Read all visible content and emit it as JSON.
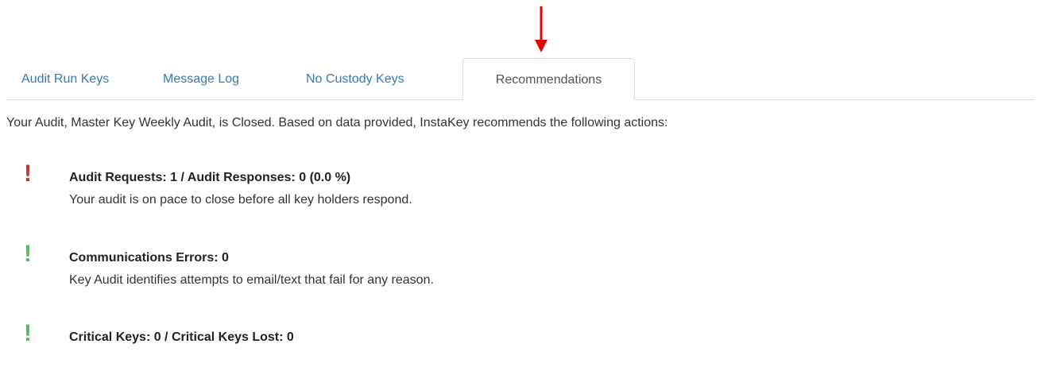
{
  "tabs": [
    {
      "label": "Audit Run Keys",
      "active": false
    },
    {
      "label": "Message Log",
      "active": false
    },
    {
      "label": "No Custody Keys",
      "active": false
    },
    {
      "label": "Recommendations",
      "active": true
    }
  ],
  "intro": "Your Audit, Master Key Weekly Audit, is Closed. Based on data provided, InstaKey recommends the following actions:",
  "recommendations": [
    {
      "icon": "exclamation-icon",
      "status": "alert",
      "status_color": "#c9302c",
      "title": "Audit Requests: 1 / Audit Responses: 0 (0.0 %)",
      "description": "Your audit is on pace to close before all key holders respond."
    },
    {
      "icon": "exclamation-icon",
      "status": "ok",
      "status_color": "#5cb85c",
      "title": "Communications Errors: 0",
      "description": "Key Audit identifies attempts to email/text that fail for any reason."
    },
    {
      "icon": "exclamation-icon",
      "status": "ok",
      "status_color": "#5cb85c",
      "title": "Critical Keys: 0 / Critical Keys Lost: 0",
      "description": ""
    }
  ],
  "annotation": {
    "icon": "red-arrow-down-icon",
    "color": "#e60000"
  },
  "colors": {
    "link": "#337ab7",
    "active_tab_text": "#555555",
    "border": "#dddddd"
  }
}
